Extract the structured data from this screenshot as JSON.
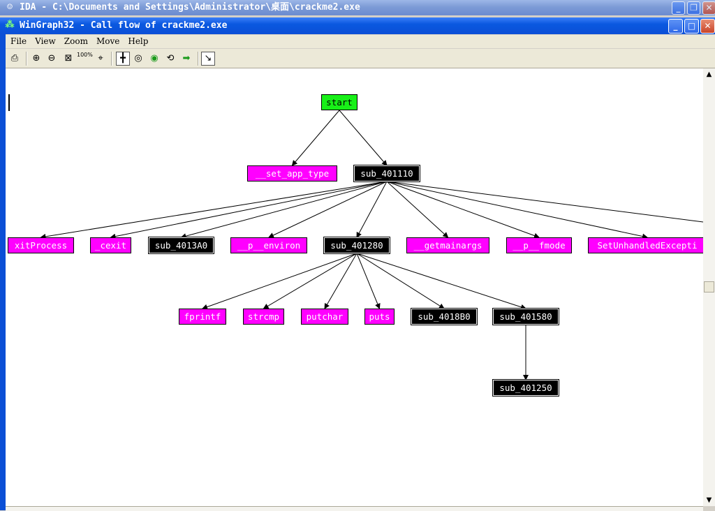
{
  "ida_window": {
    "title": "IDA - C:\\Documents and Settings\\Administrator\\桌面\\crackme2.exe",
    "icon": "ida-icon"
  },
  "wingraph_window": {
    "title": "WinGraph32 - Call flow of crackme2.exe",
    "icon": "graph-tree-icon"
  },
  "menu": [
    "File",
    "View",
    "Zoom",
    "Move",
    "Help"
  ],
  "toolbar": {
    "icons": [
      "print-icon",
      "zoom-in-icon",
      "zoom-out-icon",
      "fit-window-icon",
      "zoom-100-icon",
      "center-icon",
      "north-navigate-icon",
      "rotate-icon",
      "globe-green-icon",
      "rotate-graph-icon",
      "next-arrow-icon",
      "follow-edge-icon"
    ],
    "zoom_100_label": "100%"
  },
  "graph": {
    "colors": {
      "root": "#18f018",
      "import": "#ff00ff",
      "local": "#000000"
    },
    "nodes": {
      "start": "start",
      "set_app_type": "__set_app_type",
      "sub_401110": "sub_401110",
      "exit_process": "xitProcess",
      "cexit": "_cexit",
      "sub_4013A0": "sub_4013A0",
      "p_environ": "__p__environ",
      "sub_401280": "sub_401280",
      "getmainargs": "__getmainargs",
      "p_fmode": "__p__fmode",
      "set_unhandled": "SetUnhandledExcepti",
      "fprintf": "fprintf",
      "strcmp": "strcmp",
      "putchar": "putchar",
      "puts": "puts",
      "sub_4018B0": "sub_4018B0",
      "sub_401580": "sub_401580",
      "sub_401250": "sub_401250"
    },
    "edges": [
      [
        "start",
        "set_app_type"
      ],
      [
        "start",
        "sub_401110"
      ],
      [
        "sub_401110",
        "exit_process"
      ],
      [
        "sub_401110",
        "cexit"
      ],
      [
        "sub_401110",
        "sub_4013A0"
      ],
      [
        "sub_401110",
        "p_environ"
      ],
      [
        "sub_401110",
        "sub_401280"
      ],
      [
        "sub_401110",
        "getmainargs"
      ],
      [
        "sub_401110",
        "p_fmode"
      ],
      [
        "sub_401110",
        "set_unhandled"
      ],
      [
        "sub_401280",
        "fprintf"
      ],
      [
        "sub_401280",
        "strcmp"
      ],
      [
        "sub_401280",
        "putchar"
      ],
      [
        "sub_401280",
        "puts"
      ],
      [
        "sub_401280",
        "sub_4018B0"
      ],
      [
        "sub_401280",
        "sub_401580"
      ],
      [
        "sub_401580",
        "sub_401250"
      ]
    ]
  }
}
